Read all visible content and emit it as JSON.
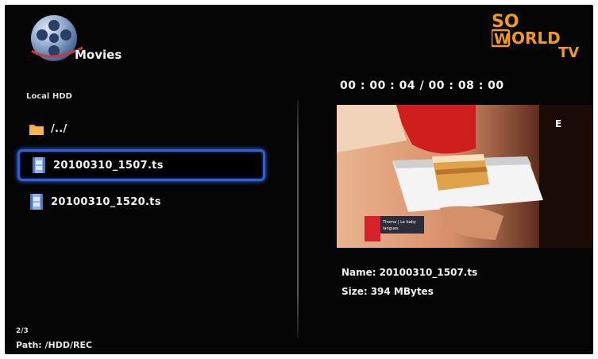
{
  "header": {
    "app_title": "Movies",
    "app_icon": "film-reel-icon",
    "brand": {
      "line1": "SO",
      "line2_box": "W",
      "line2_rest": "ORLD",
      "line3": "TV"
    }
  },
  "browser": {
    "source_label": "Local HDD",
    "items": [
      {
        "type": "folder",
        "icon": "folder-icon",
        "label": "/../",
        "selected": false
      },
      {
        "type": "video",
        "icon": "video-file-icon",
        "label": "20100310_1507.ts",
        "selected": true
      },
      {
        "type": "video",
        "icon": "video-file-icon",
        "label": "20100310_1520.ts",
        "selected": false
      }
    ],
    "counter": "2/3",
    "path": "Path: /HDD/REC"
  },
  "preview": {
    "timecode": "00 : 00 : 04 / 00 : 08 : 00",
    "channel_badge": "E",
    "caption_text": "Thoma | Le baby langues",
    "name_label": "Name:",
    "name_value": "20100310_1507.ts",
    "size_label": "Size:",
    "size_value": "394 MBytes"
  },
  "colors": {
    "background": "#050505",
    "selection": "#2e5fd8",
    "brand_orange": "#f39a1e",
    "text": "#f2f2f2"
  }
}
